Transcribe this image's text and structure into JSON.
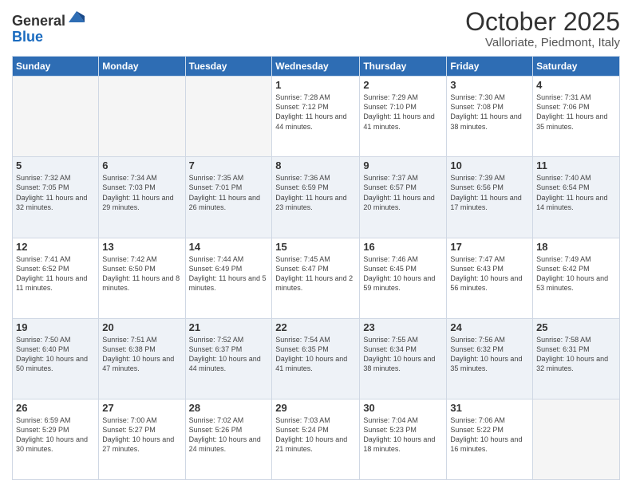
{
  "header": {
    "logo_line1": "General",
    "logo_line2": "Blue",
    "month": "October 2025",
    "location": "Valloriate, Piedmont, Italy"
  },
  "weekdays": [
    "Sunday",
    "Monday",
    "Tuesday",
    "Wednesday",
    "Thursday",
    "Friday",
    "Saturday"
  ],
  "weeks": [
    [
      {
        "day": "",
        "info": ""
      },
      {
        "day": "",
        "info": ""
      },
      {
        "day": "",
        "info": ""
      },
      {
        "day": "1",
        "info": "Sunrise: 7:28 AM\nSunset: 7:12 PM\nDaylight: 11 hours and 44 minutes."
      },
      {
        "day": "2",
        "info": "Sunrise: 7:29 AM\nSunset: 7:10 PM\nDaylight: 11 hours and 41 minutes."
      },
      {
        "day": "3",
        "info": "Sunrise: 7:30 AM\nSunset: 7:08 PM\nDaylight: 11 hours and 38 minutes."
      },
      {
        "day": "4",
        "info": "Sunrise: 7:31 AM\nSunset: 7:06 PM\nDaylight: 11 hours and 35 minutes."
      }
    ],
    [
      {
        "day": "5",
        "info": "Sunrise: 7:32 AM\nSunset: 7:05 PM\nDaylight: 11 hours and 32 minutes."
      },
      {
        "day": "6",
        "info": "Sunrise: 7:34 AM\nSunset: 7:03 PM\nDaylight: 11 hours and 29 minutes."
      },
      {
        "day": "7",
        "info": "Sunrise: 7:35 AM\nSunset: 7:01 PM\nDaylight: 11 hours and 26 minutes."
      },
      {
        "day": "8",
        "info": "Sunrise: 7:36 AM\nSunset: 6:59 PM\nDaylight: 11 hours and 23 minutes."
      },
      {
        "day": "9",
        "info": "Sunrise: 7:37 AM\nSunset: 6:57 PM\nDaylight: 11 hours and 20 minutes."
      },
      {
        "day": "10",
        "info": "Sunrise: 7:39 AM\nSunset: 6:56 PM\nDaylight: 11 hours and 17 minutes."
      },
      {
        "day": "11",
        "info": "Sunrise: 7:40 AM\nSunset: 6:54 PM\nDaylight: 11 hours and 14 minutes."
      }
    ],
    [
      {
        "day": "12",
        "info": "Sunrise: 7:41 AM\nSunset: 6:52 PM\nDaylight: 11 hours and 11 minutes."
      },
      {
        "day": "13",
        "info": "Sunrise: 7:42 AM\nSunset: 6:50 PM\nDaylight: 11 hours and 8 minutes."
      },
      {
        "day": "14",
        "info": "Sunrise: 7:44 AM\nSunset: 6:49 PM\nDaylight: 11 hours and 5 minutes."
      },
      {
        "day": "15",
        "info": "Sunrise: 7:45 AM\nSunset: 6:47 PM\nDaylight: 11 hours and 2 minutes."
      },
      {
        "day": "16",
        "info": "Sunrise: 7:46 AM\nSunset: 6:45 PM\nDaylight: 10 hours and 59 minutes."
      },
      {
        "day": "17",
        "info": "Sunrise: 7:47 AM\nSunset: 6:43 PM\nDaylight: 10 hours and 56 minutes."
      },
      {
        "day": "18",
        "info": "Sunrise: 7:49 AM\nSunset: 6:42 PM\nDaylight: 10 hours and 53 minutes."
      }
    ],
    [
      {
        "day": "19",
        "info": "Sunrise: 7:50 AM\nSunset: 6:40 PM\nDaylight: 10 hours and 50 minutes."
      },
      {
        "day": "20",
        "info": "Sunrise: 7:51 AM\nSunset: 6:38 PM\nDaylight: 10 hours and 47 minutes."
      },
      {
        "day": "21",
        "info": "Sunrise: 7:52 AM\nSunset: 6:37 PM\nDaylight: 10 hours and 44 minutes."
      },
      {
        "day": "22",
        "info": "Sunrise: 7:54 AM\nSunset: 6:35 PM\nDaylight: 10 hours and 41 minutes."
      },
      {
        "day": "23",
        "info": "Sunrise: 7:55 AM\nSunset: 6:34 PM\nDaylight: 10 hours and 38 minutes."
      },
      {
        "day": "24",
        "info": "Sunrise: 7:56 AM\nSunset: 6:32 PM\nDaylight: 10 hours and 35 minutes."
      },
      {
        "day": "25",
        "info": "Sunrise: 7:58 AM\nSunset: 6:31 PM\nDaylight: 10 hours and 32 minutes."
      }
    ],
    [
      {
        "day": "26",
        "info": "Sunrise: 6:59 AM\nSunset: 5:29 PM\nDaylight: 10 hours and 30 minutes."
      },
      {
        "day": "27",
        "info": "Sunrise: 7:00 AM\nSunset: 5:27 PM\nDaylight: 10 hours and 27 minutes."
      },
      {
        "day": "28",
        "info": "Sunrise: 7:02 AM\nSunset: 5:26 PM\nDaylight: 10 hours and 24 minutes."
      },
      {
        "day": "29",
        "info": "Sunrise: 7:03 AM\nSunset: 5:24 PM\nDaylight: 10 hours and 21 minutes."
      },
      {
        "day": "30",
        "info": "Sunrise: 7:04 AM\nSunset: 5:23 PM\nDaylight: 10 hours and 18 minutes."
      },
      {
        "day": "31",
        "info": "Sunrise: 7:06 AM\nSunset: 5:22 PM\nDaylight: 10 hours and 16 minutes."
      },
      {
        "day": "",
        "info": ""
      }
    ]
  ]
}
